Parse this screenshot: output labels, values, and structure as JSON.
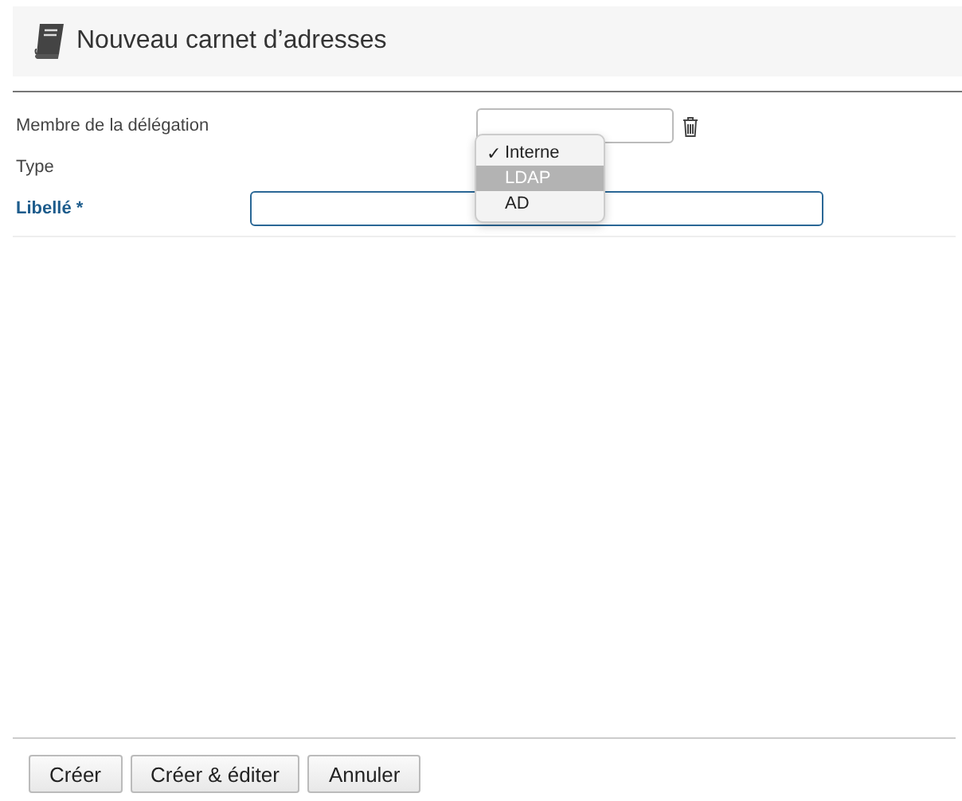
{
  "header": {
    "title": "Nouveau carnet d’adresses"
  },
  "fields": [
    {
      "kind": "picker",
      "label": "Membre de la délégation",
      "required": false
    },
    {
      "kind": "select",
      "label": "Type",
      "required": false,
      "options": [
        {
          "label": "Interne",
          "checked": true,
          "selected": false
        },
        {
          "label": "LDAP",
          "checked": false,
          "selected": true
        },
        {
          "label": "AD",
          "checked": false,
          "selected": false
        }
      ],
      "check_mark": "✓"
    },
    {
      "kind": "text",
      "label": "Libellé *",
      "required": true
    }
  ],
  "buttons": [
    "Créer",
    "Créer & éditer",
    "Annuler"
  ]
}
